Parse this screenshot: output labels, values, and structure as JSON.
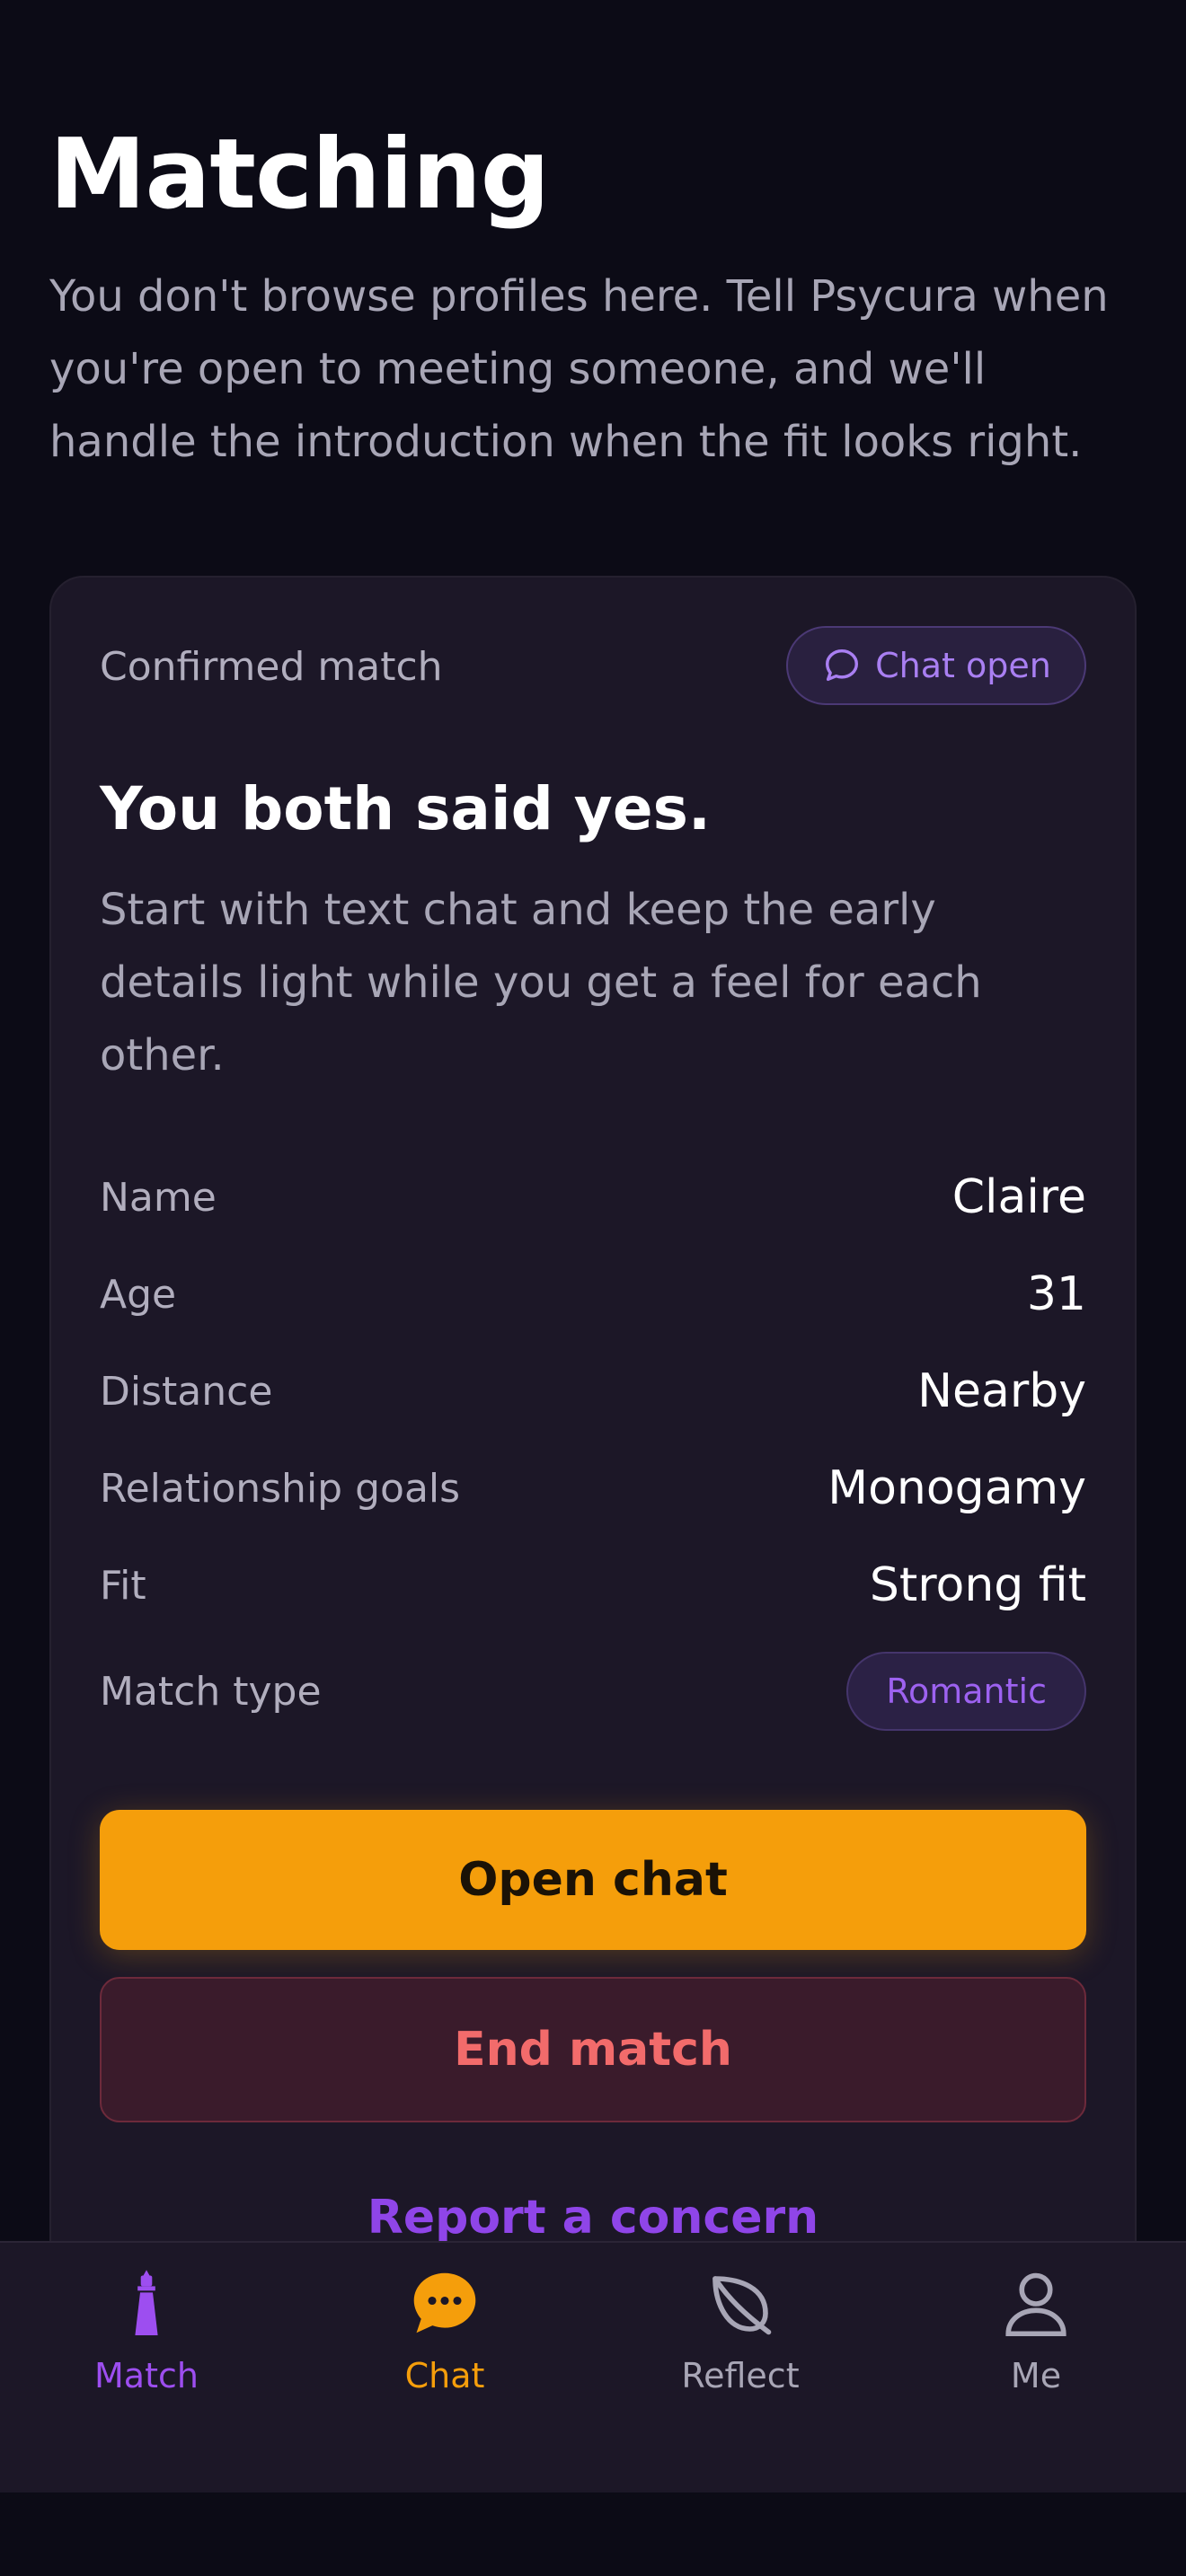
{
  "header": {
    "title": "Matching",
    "intro": "You don't browse profiles here. Tell Psycura when you're open to meeting someone, and we'll handle the introduction when the fit looks right."
  },
  "match_card": {
    "status_label": "Confirmed match",
    "chat_pill_label": "Chat open",
    "heading": "You both said yes.",
    "subtext": "Start with text chat and keep the early details light while you get a feel for each other.",
    "details": [
      {
        "label": "Name",
        "value": "Claire"
      },
      {
        "label": "Age",
        "value": "31"
      },
      {
        "label": "Distance",
        "value": "Nearby"
      },
      {
        "label": "Relationship goals",
        "value": "Monogamy"
      },
      {
        "label": "Fit",
        "value": "Strong fit"
      }
    ],
    "match_type_label": "Match type",
    "match_type_value": "Romantic",
    "open_chat_label": "Open chat",
    "end_match_label": "End match",
    "report_label": "Report a concern"
  },
  "tabbar": {
    "tabs": [
      {
        "label": "Match",
        "icon": "lighthouse-icon",
        "color": "#9d4ef0"
      },
      {
        "label": "Chat",
        "icon": "chat-bubble-icon",
        "color": "#f59e0b"
      },
      {
        "label": "Reflect",
        "icon": "leaf-icon",
        "color": "#a8a6b6"
      },
      {
        "label": "Me",
        "icon": "person-icon",
        "color": "#a8a6b6"
      }
    ]
  }
}
